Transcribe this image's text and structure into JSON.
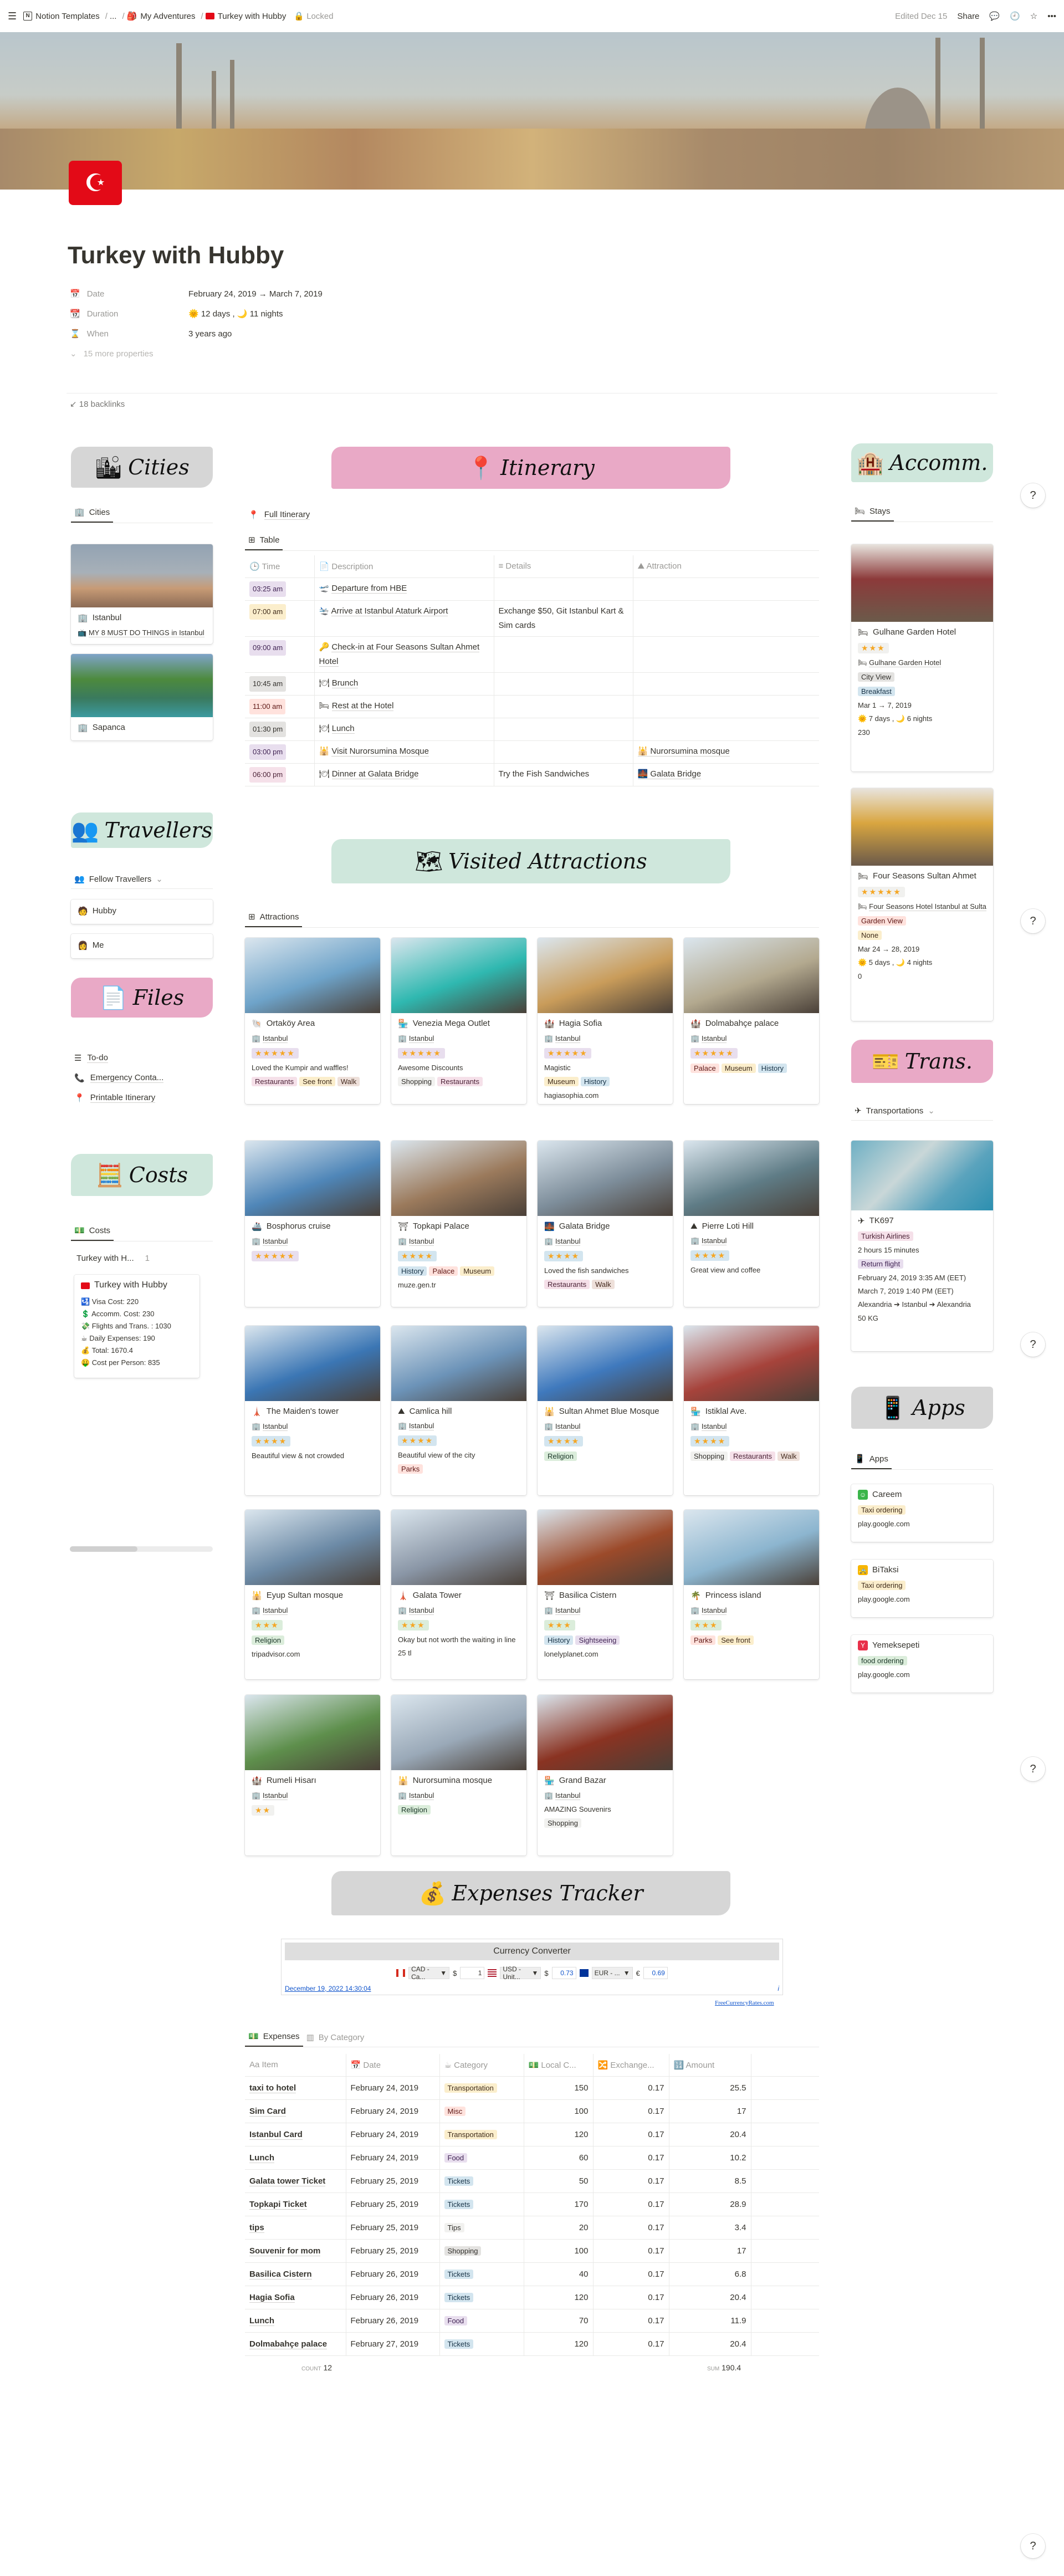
{
  "topbar": {
    "breadcrumbs": [
      "Notion Templates",
      "...",
      "My Adventures",
      "Turkey with Hubby"
    ],
    "locked": "Locked",
    "edited": "Edited Dec 15",
    "share": "Share"
  },
  "page": {
    "title": "Turkey with Hubby",
    "flag_icon": "turkey-flag",
    "properties": [
      {
        "key": "Date",
        "icon": "calendar-icon",
        "value": "February 24, 2019 → March 7, 2019"
      },
      {
        "key": "Duration",
        "icon": "calendar-page-icon",
        "value": "🌞 12 days , 🌙 11 nights"
      },
      {
        "key": "When",
        "icon": "hourglass-icon",
        "value": "3 years ago"
      }
    ],
    "more_properties": "15 more properties",
    "backlinks": "18 backlinks"
  },
  "banners": {
    "cities": "Cities",
    "itinerary": "Itinerary",
    "accomm": "Accomm.",
    "travellers": "Travellers",
    "files": "Files",
    "costs": "Costs",
    "visited": "Visited Attractions",
    "trans": "Trans.",
    "apps": "Apps",
    "expenses": "Expenses Tracker"
  },
  "cities": {
    "tab": "Cities",
    "items": [
      {
        "name": "Istanbul",
        "link": "MY 8 MUST DO THINGS in Istanbul"
      },
      {
        "name": "Sapanca",
        "link": ""
      }
    ]
  },
  "travellers": {
    "tab": "Fellow Travellers",
    "items": [
      "Hubby",
      "Me"
    ]
  },
  "files": {
    "items": [
      {
        "label": "To-do",
        "icon": "list-icon"
      },
      {
        "label": "Emergency Conta...",
        "icon": "phone-icon"
      },
      {
        "label": "Printable Itinerary",
        "icon": "pushpin-icon"
      }
    ]
  },
  "costs": {
    "tab": "Costs",
    "group": "Turkey with H...",
    "group_count": "1",
    "card_title": "Turkey with Hubby",
    "lines": [
      "🛂 Visa Cost: 220",
      "💲 Accomm. Cost: 230",
      "💸 Flights and Trans. : 1030",
      "☕ Daily Expenses: 190",
      "💰 Total: 1670.4",
      "🤑 Cost per Person: 835"
    ]
  },
  "itinerary": {
    "link": "Full Itinerary",
    "tab": "Table",
    "columns": [
      "Time",
      "Description",
      "Details",
      "Attraction"
    ],
    "rows": [
      {
        "time": "03:25 am",
        "color": "purple",
        "icon": "🛫",
        "desc": "Departure from HBE",
        "details": "",
        "attraction": ""
      },
      {
        "time": "07:00 am",
        "color": "yellow",
        "icon": "🛬",
        "desc": "Arrive at Istanbul Ataturk Airport",
        "details": "Exchange $50, Git Istanbul Kart & Sim cards",
        "attraction": ""
      },
      {
        "time": "09:00 am",
        "color": "purple",
        "icon": "🔑",
        "desc": "Check-in at Four Seasons Sultan Ahmet Hotel",
        "details": "",
        "attraction": ""
      },
      {
        "time": "10:45 am",
        "color": "grey",
        "icon": "🍽",
        "desc": "Brunch",
        "details": "",
        "attraction": ""
      },
      {
        "time": "11:00 am",
        "color": "red",
        "icon": "🛏",
        "desc": "Rest at the Hotel",
        "details": "",
        "attraction": ""
      },
      {
        "time": "01:30 pm",
        "color": "grey",
        "icon": "🍽",
        "desc": "Lunch",
        "details": "",
        "attraction": ""
      },
      {
        "time": "03:00 pm",
        "color": "purple",
        "icon": "🕌",
        "desc": "Visit Nurorsumina Mosque",
        "details": "",
        "attraction": "🕌 Nurorsumina mosque"
      },
      {
        "time": "06:00 pm",
        "color": "pink",
        "icon": "🍽",
        "desc": "Dinner at Galata Bridge",
        "details": "Try the Fish Sandwiches",
        "attraction": "🌉 Galata Bridge"
      }
    ]
  },
  "attractions": {
    "tab": "Attractions",
    "items": [
      {
        "name": "Ortaköy Area",
        "icon": "🐚",
        "city": "Istanbul",
        "stars": 5,
        "star_color": "purple",
        "note": "Loved the Kumpir and waffles!",
        "tags": [
          [
            "Restaurants",
            "pink"
          ],
          [
            "See front",
            "yellow"
          ],
          [
            "Walk",
            "brown"
          ]
        ],
        "link": "",
        "img": "#6ea3c9"
      },
      {
        "name": "Venezia Mega Outlet",
        "icon": "🏪",
        "city": "Istanbul",
        "stars": 5,
        "star_color": "purple",
        "note": "Awesome Discounts",
        "tags": [
          [
            "Shopping",
            "lightgrey"
          ],
          [
            "Restaurants",
            "pink"
          ]
        ],
        "link": "",
        "img": "#2fb8b0"
      },
      {
        "name": "Hagia Sofia",
        "icon": "🏰",
        "city": "Istanbul",
        "stars": 5,
        "star_color": "purple",
        "note": "Magistic",
        "tags": [
          [
            "Museum",
            "yellow"
          ],
          [
            "History",
            "blue"
          ]
        ],
        "link": "hagiasophia.com",
        "img": "#c99c5a"
      },
      {
        "name": "Dolmabahçe palace",
        "icon": "🏰",
        "city": "Istanbul",
        "stars": 5,
        "star_color": "purple",
        "note": "",
        "tags": [
          [
            "Palace",
            "red"
          ],
          [
            "Museum",
            "yellow"
          ],
          [
            "History",
            "blue"
          ]
        ],
        "link": "",
        "img": "#b3a98f"
      },
      {
        "name": "Bosphorus cruise",
        "icon": "🚢",
        "city": "Istanbul",
        "stars": 5,
        "star_color": "purple",
        "note": "",
        "tags": [],
        "link": "",
        "img": "#4f86b8"
      },
      {
        "name": "Topkapi Palace",
        "icon": "⛩",
        "city": "Istanbul",
        "stars": 4,
        "star_color": "blue",
        "note": "",
        "tags": [
          [
            "History",
            "blue"
          ],
          [
            "Palace",
            "red"
          ],
          [
            "Museum",
            "yellow"
          ]
        ],
        "link": "muze.gen.tr",
        "img": "#9b7a5c"
      },
      {
        "name": "Galata Bridge",
        "icon": "🌉",
        "city": "Istanbul",
        "stars": 4,
        "star_color": "blue",
        "note": "Loved the fish sandwiches",
        "tags": [
          [
            "Restaurants",
            "pink"
          ],
          [
            "Walk",
            "brown"
          ]
        ],
        "link": "",
        "img": "#7d8d9a"
      },
      {
        "name": "Pierre Loti Hill",
        "icon": "⛰",
        "city": "Istanbul",
        "stars": 4,
        "star_color": "blue",
        "note": "Great view and coffee",
        "tags": [],
        "link": "",
        "img": "#5f7c86"
      },
      {
        "name": "The Maiden's tower",
        "icon": "🗼",
        "city": "Istanbul",
        "stars": 4,
        "star_color": "blue",
        "note": "Beautiful view & not crowded",
        "tags": [],
        "link": "",
        "img": "#3b76b4"
      },
      {
        "name": "Camlica hill",
        "icon": "⛰",
        "city": "Istanbul",
        "stars": 4,
        "star_color": "blue",
        "note": "Beautiful view of the city",
        "tags": [
          [
            "Parks",
            "red"
          ]
        ],
        "link": "",
        "img": "#6c93b8"
      },
      {
        "name": "Sultan Ahmet Blue Mosque",
        "icon": "🕌",
        "city": "Istanbul",
        "stars": 4,
        "star_color": "blue",
        "note": "",
        "tags": [
          [
            "Religion",
            "green"
          ]
        ],
        "link": "",
        "img": "#3f79bd"
      },
      {
        "name": "Istiklal Ave.",
        "icon": "🏪",
        "city": "Istanbul",
        "stars": 4,
        "star_color": "blue",
        "note": "",
        "tags": [
          [
            "Shopping",
            "lightgrey"
          ],
          [
            "Restaurants",
            "pink"
          ],
          [
            "Walk",
            "brown"
          ]
        ],
        "link": "",
        "img": "#a6433b"
      },
      {
        "name": "Eyup Sultan mosque",
        "icon": "🕌",
        "city": "Istanbul",
        "stars": 3,
        "star_color": "green",
        "note": "",
        "tags": [
          [
            "Religion",
            "green"
          ]
        ],
        "link": "tripadvisor.com",
        "img": "#6c8aa6"
      },
      {
        "name": "Galata Tower",
        "icon": "🗼",
        "city": "Istanbul",
        "stars": 3,
        "star_color": "green",
        "note": "Okay but not worth the waiting in line",
        "tags": [],
        "link": "25 tl",
        "img": "#8a96a6"
      },
      {
        "name": "Basilica Cistern",
        "icon": "⛩",
        "city": "Istanbul",
        "stars": 3,
        "star_color": "green",
        "note": "",
        "tags": [
          [
            "History",
            "blue"
          ],
          [
            "Sightseeing",
            "purple"
          ]
        ],
        "link": "lonelyplanet.com",
        "img": "#9c4a2a"
      },
      {
        "name": "Princess island",
        "icon": "🌴",
        "city": "Istanbul",
        "stars": 3,
        "star_color": "green",
        "note": "",
        "tags": [
          [
            "Parks",
            "red"
          ],
          [
            "See front",
            "yellow"
          ]
        ],
        "link": "",
        "img": "#8cb5cf"
      },
      {
        "name": "Rumeli Hisarı",
        "icon": "🏰",
        "city": "Istanbul",
        "stars": 2,
        "star_color": "lightgrey",
        "note": "",
        "tags": [],
        "link": "",
        "img": "#5e8f4c"
      },
      {
        "name": "Nurorsumina mosque",
        "icon": "🕌",
        "city": "Istanbul",
        "stars": 0,
        "star_color": "",
        "note": "",
        "tags": [
          [
            "Religion",
            "green"
          ]
        ],
        "link": "",
        "img": "#9aa9b8"
      },
      {
        "name": "Grand Bazar",
        "icon": "🏪",
        "city": "Istanbul",
        "stars": 0,
        "star_color": "",
        "note": "AMAZING Souvenirs",
        "tags": [
          [
            "Shopping",
            "lightgrey"
          ]
        ],
        "link": "",
        "img": "#8a3322"
      }
    ]
  },
  "stays": {
    "tab": "Stays",
    "items": [
      {
        "name": "Gulhane Garden Hotel",
        "stars": 3,
        "link": "Gulhane Garden Hotel",
        "view": [
          "City View",
          "grey"
        ],
        "meal": [
          "Breakfast",
          "blue"
        ],
        "dates": "Mar 1 → 7, 2019",
        "duration": "🌞 7 days , 🌙 6 nights",
        "cost": "230",
        "img": "#8c3a3a"
      },
      {
        "name": "Four Seasons Sultan Ahmet",
        "stars": 5,
        "link": "Four Seasons Hotel Istanbul at Sultanahmet",
        "view": [
          "Garden View",
          "red"
        ],
        "meal": [
          "None",
          "yellow"
        ],
        "dates": "Mar 24 → 28, 2019",
        "duration": "🌞 5 days , 🌙 4 nights",
        "cost": "0",
        "img": "#d9a640"
      }
    ]
  },
  "transport": {
    "tab": "Transportations",
    "items": [
      {
        "name": "TK697",
        "airline": "Turkish Airlines",
        "duration": "2 hours 15 minutes",
        "type": "Return flight",
        "depart": "February 24, 2019 3:35 AM (EET)",
        "return": "March 7, 2019 1:40 PM (EET)",
        "route": "Alexandria ➔ Istanbul ➔ Alexandria",
        "baggage": "50 KG"
      }
    ]
  },
  "apps": {
    "tab": "Apps",
    "items": [
      {
        "name": "Careem",
        "icon_color": "#3bb54a",
        "icon": "☺",
        "tag": [
          "Taxi ordering",
          "yellow"
        ],
        "link": "play.google.com"
      },
      {
        "name": "BiTaksi",
        "icon_color": "#f7b500",
        "icon": "🚕",
        "tag": [
          "Taxi ordering",
          "yellow"
        ],
        "link": "play.google.com"
      },
      {
        "name": "Yemeksepeti",
        "icon_color": "#e8304a",
        "icon": "Y",
        "tag": [
          "food ordering",
          "green"
        ],
        "link": "play.google.com"
      }
    ]
  },
  "converter": {
    "title": "Currency Converter",
    "from": {
      "code": "CAD - Ca...",
      "symbol": "$",
      "value": "1"
    },
    "to1": {
      "code": "USD - Unit...",
      "symbol": "$",
      "value": "0.73"
    },
    "to2": {
      "code": "EUR - ...",
      "symbol": "€",
      "value": "0.69"
    },
    "timestamp": "December 19, 2022 14:30:04",
    "credit": "FreeCurrencyRates.com",
    "info": "i"
  },
  "expenses": {
    "tabs": [
      "Expenses",
      "By Category"
    ],
    "columns": [
      "Item",
      "Date",
      "Category",
      "Local C...",
      "Exchange...",
      "Amount"
    ],
    "rows": [
      {
        "item": "taxi to hotel",
        "date": "February 24, 2019",
        "cat": [
          "Transportation",
          "yellow"
        ],
        "local": "150",
        "rate": "0.17",
        "amount": "25.5"
      },
      {
        "item": "Sim Card",
        "date": "February 24, 2019",
        "cat": [
          "Misc",
          "red"
        ],
        "local": "100",
        "rate": "0.17",
        "amount": "17"
      },
      {
        "item": "Istanbul Card",
        "date": "February 24, 2019",
        "cat": [
          "Transportation",
          "yellow"
        ],
        "local": "120",
        "rate": "0.17",
        "amount": "20.4"
      },
      {
        "item": "Lunch",
        "date": "February 24, 2019",
        "cat": [
          "Food",
          "purple"
        ],
        "local": "60",
        "rate": "0.17",
        "amount": "10.2"
      },
      {
        "item": "Galata tower Ticket",
        "date": "February 25, 2019",
        "cat": [
          "Tickets",
          "blue"
        ],
        "local": "50",
        "rate": "0.17",
        "amount": "8.5"
      },
      {
        "item": "Topkapi Ticket",
        "date": "February 25, 2019",
        "cat": [
          "Tickets",
          "blue"
        ],
        "local": "170",
        "rate": "0.17",
        "amount": "28.9"
      },
      {
        "item": "tips",
        "date": "February 25, 2019",
        "cat": [
          "Tips",
          "lightgrey"
        ],
        "local": "20",
        "rate": "0.17",
        "amount": "3.4"
      },
      {
        "item": "Souvenir for mom",
        "date": "February 25, 2019",
        "cat": [
          "Shopping",
          "grey"
        ],
        "local": "100",
        "rate": "0.17",
        "amount": "17"
      },
      {
        "item": "Basilica Cistern",
        "date": "February 26, 2019",
        "cat": [
          "Tickets",
          "blue"
        ],
        "local": "40",
        "rate": "0.17",
        "amount": "6.8"
      },
      {
        "item": "Hagia Sofia",
        "date": "February 26, 2019",
        "cat": [
          "Tickets",
          "blue"
        ],
        "local": "120",
        "rate": "0.17",
        "amount": "20.4"
      },
      {
        "item": "Lunch",
        "date": "February 26, 2019",
        "cat": [
          "Food",
          "purple"
        ],
        "local": "70",
        "rate": "0.17",
        "amount": "11.9"
      },
      {
        "item": "Dolmabahçe palace",
        "date": "February 27, 2019",
        "cat": [
          "Tickets",
          "blue"
        ],
        "local": "120",
        "rate": "0.17",
        "amount": "20.4"
      }
    ],
    "count_label": "COUNT",
    "count": "12",
    "sum_label": "SUM",
    "sum": "190.4"
  },
  "help": "?"
}
